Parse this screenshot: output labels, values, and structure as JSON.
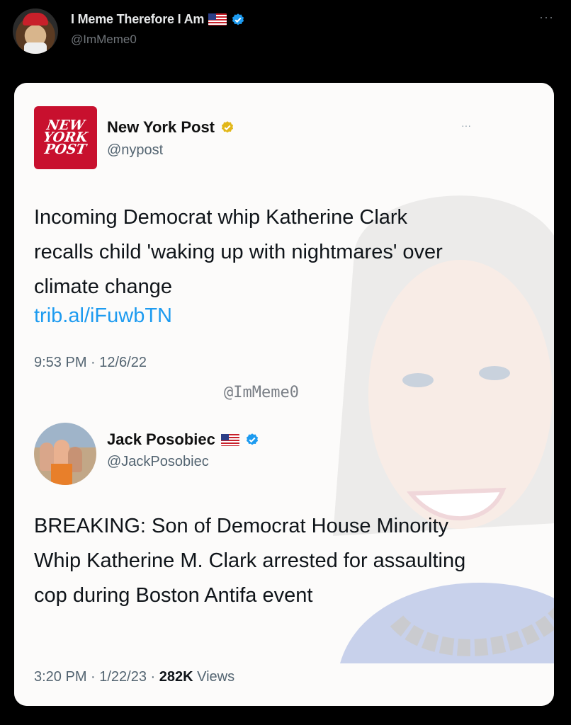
{
  "outer_tweet": {
    "display_name": "I Meme Therefore I Am",
    "handle": "@ImMeme0",
    "more": "···"
  },
  "quoted_tweet": {
    "logo_lines": [
      "NEW",
      "YORK",
      "POST"
    ],
    "display_name": "New York Post",
    "handle": "@nypost",
    "more": "···",
    "text": "Incoming Democrat whip Katherine Clark recalls child 'waking up with nightmares' over climate change",
    "link": "trib.al/iFuwbTN",
    "timestamp": "9:53 PM · 12/6/22"
  },
  "watermark": "@ImMeme0",
  "reply_tweet": {
    "display_name": "Jack Posobiec",
    "handle": "@JackPosobiec",
    "text": "BREAKING: Son of Democrat House Minority Whip Katherine M. Clark arrested for assaulting cop during Boston Antifa event",
    "timestamp": "3:20 PM · 1/22/23 · ",
    "views_count": "282K",
    "views_label": " Views"
  },
  "colors": {
    "background": "#000000",
    "verified_blue": "#1d9bf0",
    "verified_gold": "#e2b719",
    "nypost_red": "#c8102e"
  },
  "icons": [
    "verified-badge-icon",
    "us-flag-icon",
    "more-icon"
  ]
}
